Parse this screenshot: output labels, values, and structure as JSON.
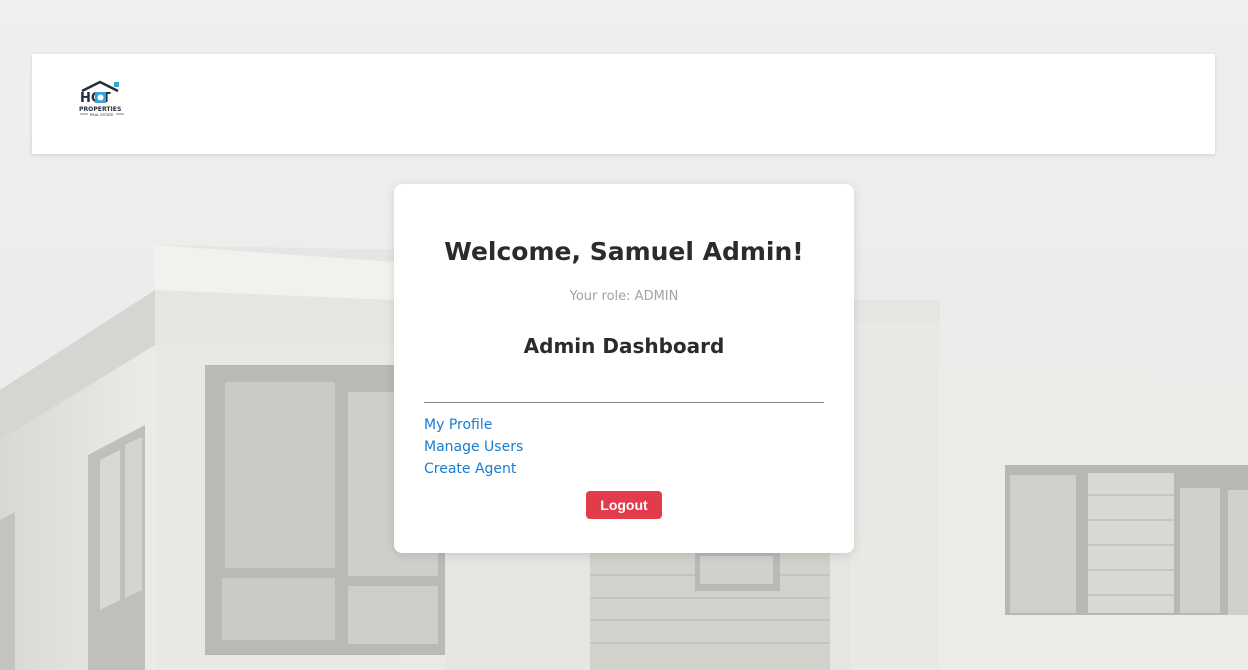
{
  "header": {
    "logo": {
      "alt": "Hot Properties Real Estate",
      "line1": "HOT",
      "line2": "PROPERTIES",
      "line3": "REAL ESTATE"
    }
  },
  "card": {
    "welcome": "Welcome, Samuel Admin!",
    "role_prefix": "Your role: ",
    "role_value": "ADMIN",
    "dashboard_title": "Admin Dashboard",
    "links": [
      {
        "label": "My Profile"
      },
      {
        "label": "Manage Users"
      },
      {
        "label": "Create Agent"
      }
    ],
    "logout_label": "Logout"
  },
  "colors": {
    "link": "#1a7bd0",
    "logout": "#e23b4b",
    "background": "#efefef"
  }
}
